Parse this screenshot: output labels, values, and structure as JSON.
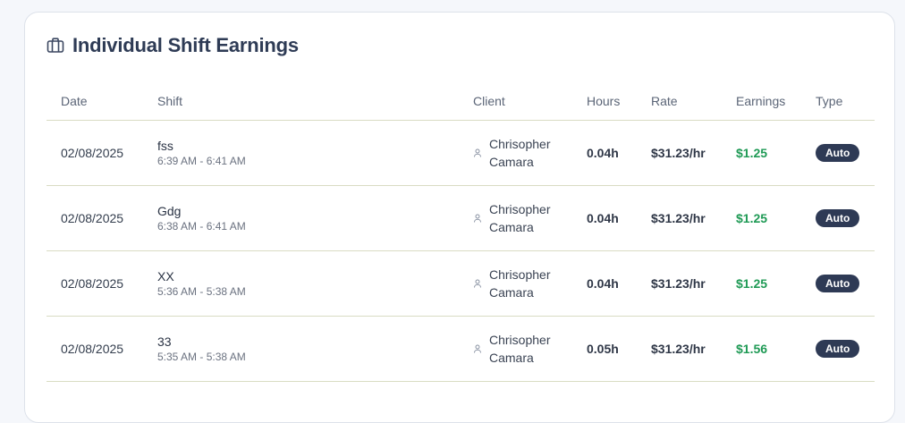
{
  "card": {
    "title": "Individual Shift Earnings",
    "title_icon": "briefcase-icon"
  },
  "table": {
    "headers": [
      "Date",
      "Shift",
      "Client",
      "Hours",
      "Rate",
      "Earnings",
      "Type"
    ],
    "rows": [
      {
        "date": "02/08/2025",
        "shift_name": "fss",
        "shift_time": "6:39 AM - 6:41 AM",
        "client": "Chrisopher Camara",
        "hours": "0.04h",
        "rate": "$31.23/hr",
        "earnings": "$1.25",
        "type": "Auto"
      },
      {
        "date": "02/08/2025",
        "shift_name": "Gdg",
        "shift_time": "6:38 AM - 6:41 AM",
        "client": "Chrisopher Camara",
        "hours": "0.04h",
        "rate": "$31.23/hr",
        "earnings": "$1.25",
        "type": "Auto"
      },
      {
        "date": "02/08/2025",
        "shift_name": "XX",
        "shift_time": "5:36 AM - 5:38 AM",
        "client": "Chrisopher Camara",
        "hours": "0.04h",
        "rate": "$31.23/hr",
        "earnings": "$1.25",
        "type": "Auto"
      },
      {
        "date": "02/08/2025",
        "shift_name": "33",
        "shift_time": "5:35 AM - 5:38 AM",
        "client": "Chrisopher Camara",
        "hours": "0.05h",
        "rate": "$31.23/hr",
        "earnings": "$1.56",
        "type": "Auto"
      }
    ]
  },
  "colors": {
    "earnings": "#1f9a55",
    "badge": "#2e3a55",
    "title": "#2e3b55"
  }
}
